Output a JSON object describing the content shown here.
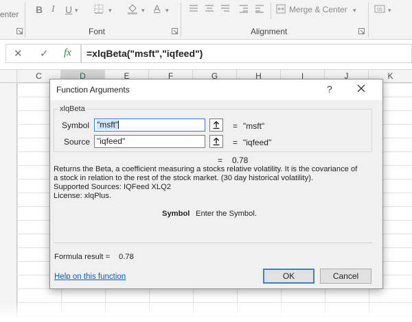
{
  "ribbon": {
    "partial_center_label": "enter",
    "font_group_label": "Font",
    "alignment_group_label": "Alignment",
    "merge_center_label": "Merge & Center",
    "bold": "B",
    "italic": "I",
    "underline": "U",
    "font_color": "A"
  },
  "formula_bar": {
    "cancel_icon": "✕",
    "enter_icon": "✓",
    "fx_label": "fx",
    "formula": "=xlqBeta(\"msft\",\"iqfeed\")"
  },
  "grid": {
    "columns": [
      "C",
      "D",
      "E",
      "F",
      "G",
      "H",
      "I",
      "J",
      "K"
    ],
    "selected_column": "D"
  },
  "dialog": {
    "title": "Function Arguments",
    "help_glyph": "?",
    "function_name": "xlqBeta",
    "arguments": [
      {
        "label": "Symbol",
        "input": "\"msft\"",
        "equals": "=",
        "value": "\"msft\""
      },
      {
        "label": "Source",
        "input": "\"iqfeed\"",
        "equals": "=",
        "value": "\"iqfeed\""
      }
    ],
    "result_equals": "=",
    "result_value": "0.78",
    "description": [
      "Returns the Beta, a coefficient measuring a stocks relative volatility. It is the covariance of",
      "a stock in relation to the rest of the stock market. (30 day historical volatility).",
      "Supported Sources:  IQFeed XLQ2",
      "License: xlqPlus."
    ],
    "arg_help_name": "Symbol",
    "arg_help_text": "Enter the Symbol.",
    "formula_result_label": "Formula result =",
    "formula_result_value": "0.78",
    "help_link": "Help on this function",
    "ok_label": "OK",
    "cancel_label": "Cancel"
  },
  "colors": {
    "accent_blue": "#3c7fd1",
    "link_blue": "#0a5bb5",
    "excel_green": "#217346",
    "dialog_bg": "#f0f0f0"
  }
}
